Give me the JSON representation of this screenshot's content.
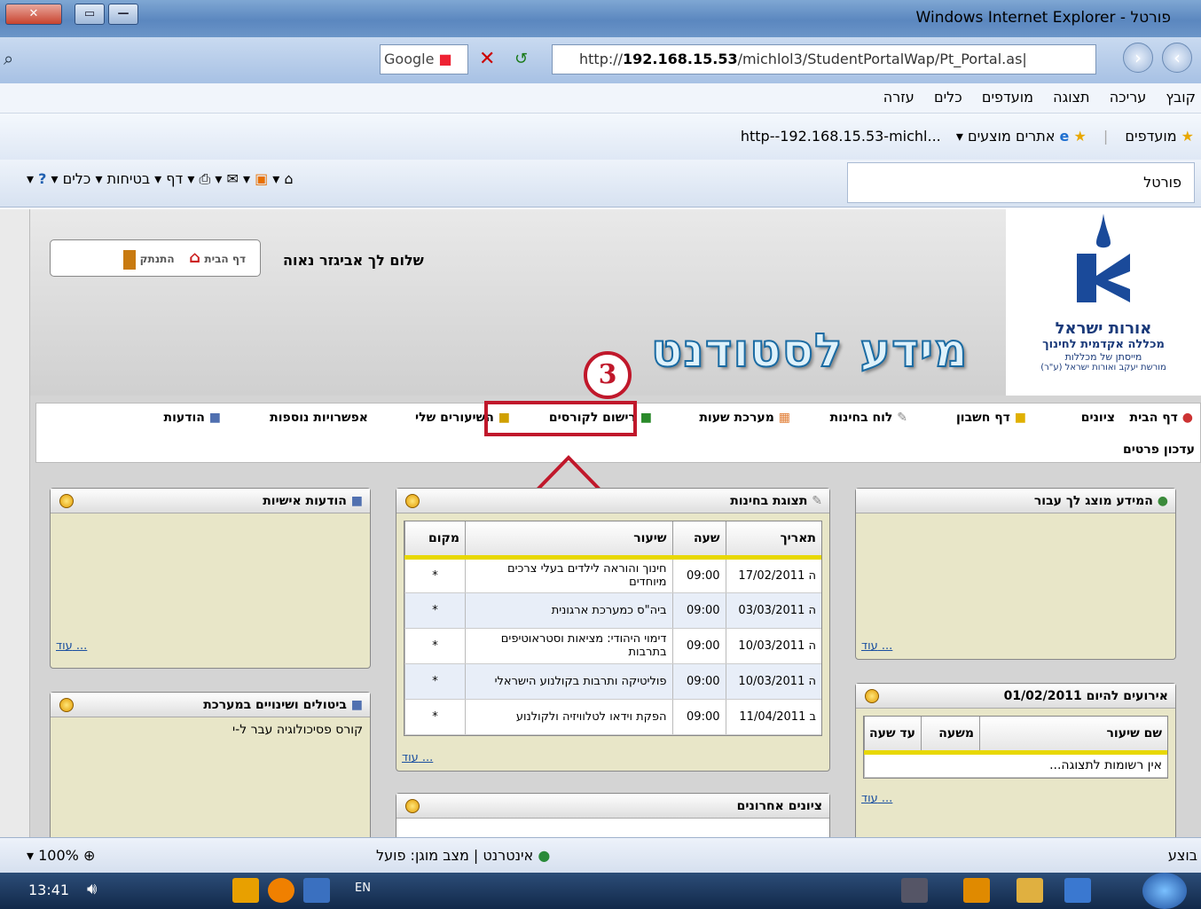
{
  "window": {
    "title": "פורטל - Windows Internet Explorer"
  },
  "address": {
    "google_label": "Google",
    "url_prefix": "http://",
    "url_host": "192.168.15.53",
    "url_path": "/michlol3/StudentPortalWap/Pt_Portal.as|"
  },
  "menu": [
    "קובץ",
    "עריכה",
    "תצוגה",
    "מועדפים",
    "כלים",
    "עזרה"
  ],
  "favorites": {
    "label": "מועדפים",
    "suggested": "אתרים מוצעים",
    "link": "...http--192.168.15.53-michl"
  },
  "tab": {
    "title": "פורטל"
  },
  "commands": [
    "דף",
    "בטיחות",
    "כלים"
  ],
  "header": {
    "greeting": "שלום לך אביגזר נאוה",
    "home_label": "דף הבית",
    "logout_label": "התנתק",
    "big_title": "מידע לסטודנט",
    "logo_name": "אורות ישראל",
    "logo_sub": "מכללה אקדמית לחינוך",
    "logo_line3": "מייסתן של מכללות",
    "logo_line4": "מורשת יעקב ואורות ישראל (ע\"ר)"
  },
  "nav": {
    "items": [
      "דף הבית",
      "ציונים",
      "דף חשבון",
      "לוח בחינות",
      "מערכת שעות",
      "רישום לקורסים",
      "השיעורים שלי",
      "אפשרויות נוספות",
      "הודעות"
    ],
    "sub": "עדכון פרטים"
  },
  "annotation": {
    "step": "3"
  },
  "panels": {
    "info": {
      "title": "המידע מוצג לך עבור",
      "more": "עוד ..."
    },
    "events": {
      "title": "אירועים להיום 01/02/2011",
      "cols": [
        "שם שיעור",
        "משעה",
        "עד שעה"
      ],
      "empty": "אין רשומות לתצוגה...",
      "more": "עוד ..."
    },
    "exams": {
      "title": "תצוגת בחינות",
      "cols": [
        "תאריך",
        "שעה",
        "שיעור",
        "מקום"
      ],
      "rows": [
        [
          "ה 17/02/2011",
          "09:00",
          "חינוך והוראה לילדים בעלי צרכים מיוחדים",
          "*"
        ],
        [
          "ה 03/03/2011",
          "09:00",
          "ביה\"ס כמערכת ארגונית",
          "*"
        ],
        [
          "ה 10/03/2011",
          "09:00",
          "דימוי היהודי: מציאות וסטראוטיפים בתרבות",
          "*"
        ],
        [
          "ה 10/03/2011",
          "09:00",
          "פוליטיקה ותרבות בקולנוע הישראלי",
          "*"
        ],
        [
          "ב 11/04/2011",
          "09:00",
          "הפקת וידאו לטלוויזיה ולקולנוע",
          "*"
        ]
      ],
      "more": "עוד ..."
    },
    "grades": {
      "title": "ציונים אחרונים"
    },
    "messages": {
      "title": "הודעות אישיות",
      "more": "עוד ..."
    },
    "changes": {
      "title": "ביטולים ושינויים במערכת",
      "text": "קורס פסיכולוגיה עבר ל-י"
    }
  },
  "status": {
    "zone": "אינטרנט | מצב מוגן: פועל",
    "zoom": "100%",
    "right": "בוצע"
  },
  "taskbar": {
    "time": "13:41",
    "lang": "EN"
  }
}
